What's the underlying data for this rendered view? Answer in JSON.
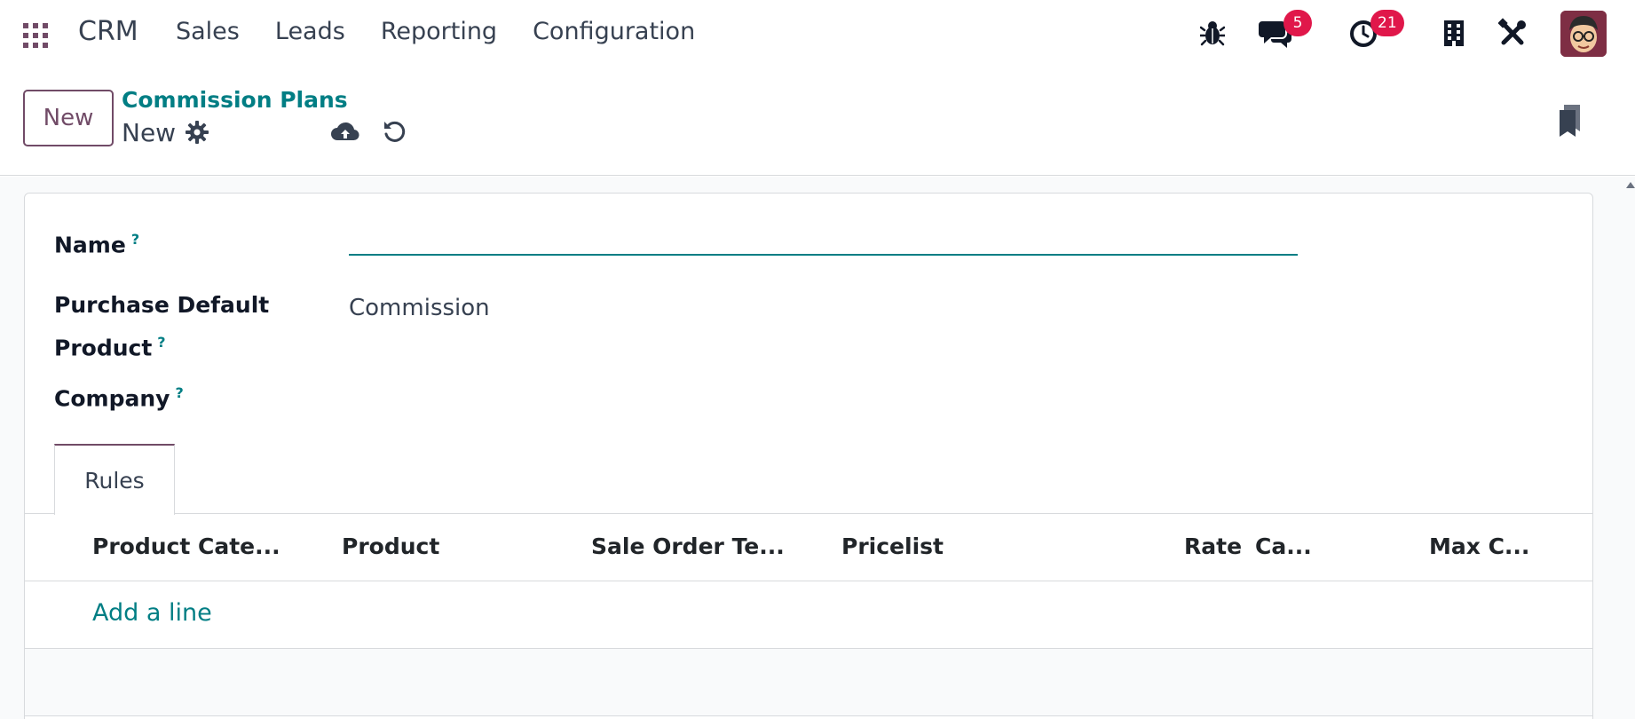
{
  "navbar": {
    "app_name": "CRM",
    "menu": [
      "Sales",
      "Leads",
      "Reporting",
      "Configuration"
    ],
    "icons": [
      "apps-grid-icon",
      "bug-icon",
      "chat-icon",
      "clock-icon",
      "building-icon",
      "tools-icon",
      "avatar"
    ],
    "messages_count": "5",
    "activities_count": "21"
  },
  "control": {
    "new_label": "New",
    "breadcrumb": "Commission Plans",
    "record_name": "New"
  },
  "form": {
    "name_label": "Name",
    "name_value": "",
    "product_label_line1": "Purchase Default",
    "product_label_line2": "Product",
    "product_value": "Commission",
    "company_label": "Company",
    "help_mark": "?"
  },
  "tabs": [
    "Rules"
  ],
  "table": {
    "columns": [
      "Product Cate...",
      "Product",
      "Sale Order Te...",
      "Pricelist",
      "Rate",
      "Ca...",
      "Max C..."
    ],
    "add_line": "Add a line"
  },
  "colors": {
    "brand": "#714b67",
    "accent": "#017e84",
    "badge": "#e0174a"
  }
}
